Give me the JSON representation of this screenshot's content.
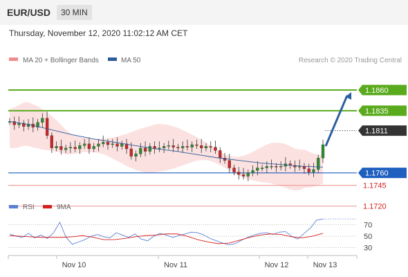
{
  "header": {
    "symbol": "EUR/USD",
    "timeframe": "30 MIN",
    "datetime": "Thursday, November 12, 2020 11:02:12 AM CET"
  },
  "legend": {
    "items": [
      {
        "label": "MA 20 + Bollinger Bands",
        "color": "#f08c8c"
      },
      {
        "label": "MA 50",
        "color": "#2e5c99"
      }
    ],
    "credit": "Research © 2020 Trading Central"
  },
  "rsi_legend": {
    "items": [
      {
        "label": "RSI",
        "color": "#5b7fd6"
      },
      {
        "label": "9MA",
        "color": "#d62020"
      }
    ]
  },
  "colors": {
    "resistance": "#5aaa1e",
    "pivot": "#1f5fc0",
    "support": "#f0a0a0",
    "support_text": "#d62020",
    "arrow": "#2a5e9e",
    "last_price_bg": "#333333",
    "bollinger_fill": "#fbd7d7"
  },
  "chart_data": [
    {
      "type": "line",
      "title": "",
      "x_ticks": [
        "Nov 10",
        "Nov 11",
        "Nov 12",
        "Nov 13"
      ],
      "ylim": [
        1.1738,
        1.1875
      ],
      "series": [
        {
          "name": "EUR/USD",
          "values": [
            1.1822,
            1.1818,
            1.182,
            1.1816,
            1.1819,
            1.1815,
            1.1821,
            1.1826,
            1.1805,
            1.179,
            1.1792,
            1.1788,
            1.179,
            1.1791,
            1.1789,
            1.1793,
            1.1795,
            1.1789,
            1.1792,
            1.1795,
            1.1797,
            1.1794,
            1.1795,
            1.1792,
            1.1795,
            1.1789,
            1.178,
            1.1783,
            1.179,
            1.1786,
            1.1792,
            1.1789,
            1.179,
            1.1792,
            1.1793,
            1.1791,
            1.179,
            1.1792,
            1.1791,
            1.1794,
            1.1793,
            1.179,
            1.1792,
            1.1791,
            1.1787,
            1.1778,
            1.1775,
            1.1766,
            1.1761,
            1.1758,
            1.1756,
            1.176,
            1.1763,
            1.1766,
            1.1766,
            1.1768,
            1.1768,
            1.1767,
            1.1768,
            1.1771,
            1.1769,
            1.1767,
            1.1768,
            1.1765,
            1.1761,
            1.1764,
            1.1778,
            1.1794
          ]
        },
        {
          "name": "MA 50",
          "values": [
            1.1822,
            1.1818,
            1.1812,
            1.1806,
            1.1801,
            1.1797,
            1.1793,
            1.1789,
            1.1786,
            1.1782,
            1.1778,
            1.1775,
            1.1772,
            1.177,
            1.1768,
            1.1767
          ]
        },
        {
          "name": "RSI",
          "values": [
            54,
            50,
            48,
            55,
            47,
            52,
            46,
            56,
            74,
            48,
            36,
            40,
            44,
            50,
            53,
            49,
            47,
            56,
            52,
            48,
            54,
            45,
            42,
            50,
            55,
            52,
            48,
            51,
            54,
            57,
            56,
            52,
            46,
            42,
            38,
            35,
            37,
            43,
            48,
            52,
            55,
            56,
            53,
            57,
            58,
            50,
            45,
            55,
            64,
            78,
            80
          ]
        },
        {
          "name": "9MA",
          "values": [
            51,
            50,
            49,
            48,
            48,
            48,
            49,
            51,
            48,
            44,
            44,
            46,
            49,
            51,
            52,
            54,
            54,
            50,
            44,
            40,
            37,
            38,
            43,
            48,
            52,
            54,
            53,
            49,
            47,
            50,
            55
          ]
        }
      ],
      "levels": {
        "resistance": [
          1.186,
          1.1835
        ],
        "last": 1.1811,
        "pivot": 1.176,
        "support": [
          1.1745,
          1.172
        ]
      },
      "rsi_levels": [
        70,
        50,
        30
      ]
    }
  ]
}
